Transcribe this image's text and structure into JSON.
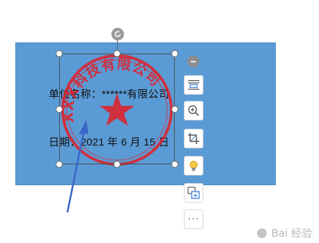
{
  "document": {
    "line1": "单位名称：******有限公司",
    "line2": "日期：2021 年 6 月 15 日"
  },
  "stamp": {
    "text": "XXX科技有限公司",
    "color": "#e0242c",
    "icon": "star-icon"
  },
  "toolbar": {
    "more_label": "···",
    "icons": [
      "collapse-icon",
      "wrap-text-icon",
      "zoom-in-icon",
      "crop-icon",
      "lightbulb-icon",
      "convert-icon"
    ]
  },
  "annotation": {
    "color": "#3a67c8",
    "icon": "arrow-icon"
  },
  "colors": {
    "frame": "#5b9bd5",
    "selection": "#4b4b4b"
  },
  "watermark": {
    "text": "Bai 经验"
  }
}
